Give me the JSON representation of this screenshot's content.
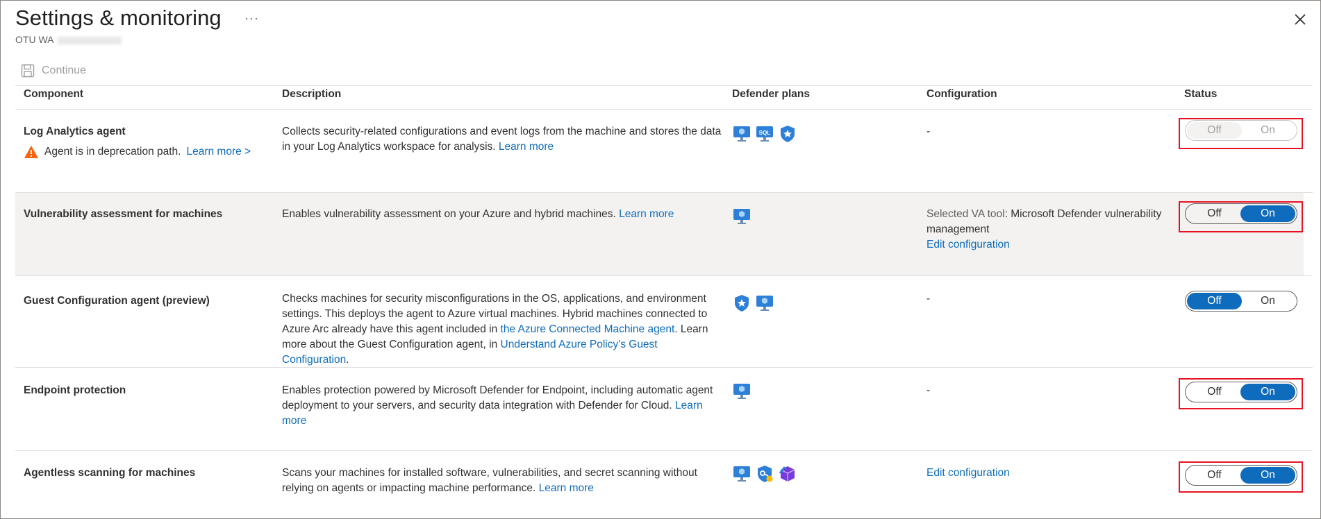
{
  "page": {
    "title": "Settings & monitoring",
    "more": "···",
    "subtitle_visible": "OTU WA"
  },
  "toolbar": {
    "continue_label": "Continue"
  },
  "columns": {
    "component": "Component",
    "description": "Description",
    "plans": "Defender plans",
    "configuration": "Configuration",
    "status": "Status"
  },
  "toggle_labels": {
    "off": "Off",
    "on": "On"
  },
  "rows": [
    {
      "name": "Log Analytics agent",
      "warning_text": "Agent is in deprecation path.",
      "warning_link": "Learn more >",
      "desc_text": "Collects security-related configurations and event logs from the machine and stores the data in your Log Analytics workspace for analysis.",
      "desc_link": "Learn more",
      "plans": [
        "server-monitor-icon",
        "sql-server-icon",
        "shield-star-icon"
      ],
      "config": "-",
      "status": "Off",
      "status_enabled": false
    },
    {
      "name": "Vulnerability assessment for machines",
      "desc_text": "Enables vulnerability assessment on your Azure and hybrid machines.",
      "desc_link": "Learn more",
      "plans": [
        "server-monitor-icon"
      ],
      "config_prefix": "Selected VA tool",
      "config_value": ": Microsoft Defender vulnerability management",
      "config_link": "Edit configuration",
      "status": "On",
      "status_enabled": true
    },
    {
      "name": "Guest Configuration agent (preview)",
      "desc_text": "Checks machines for security misconfigurations in the OS, applications, and environment settings. This deploys the agent to Azure virtual machines. Hybrid machines connected to Azure Arc already have this agent included in",
      "desc_link": "the Azure Connected Machine agent",
      "desc_text2": ". Learn more about the Guest Configuration agent, in",
      "desc_link2": "Understand Azure Policy's Guest Configuration",
      "desc_text3": ".",
      "plans": [
        "shield-star-icon",
        "server-monitor-icon"
      ],
      "config": "-",
      "status": "Off",
      "status_enabled": true
    },
    {
      "name": "Endpoint protection",
      "desc_text": "Enables protection powered by Microsoft Defender for Endpoint, including automatic agent deployment to your servers, and security data integration with Defender for Cloud.",
      "desc_link": "Learn more",
      "plans": [
        "server-monitor-icon"
      ],
      "config": "-",
      "status": "On",
      "status_enabled": true
    },
    {
      "name": "Agentless scanning for machines",
      "desc_text": "Scans your machines for installed software, vulnerabilities, and secret scanning without relying on agents or impacting machine performance.",
      "desc_link": "Learn more",
      "plans": [
        "server-monitor-icon",
        "shield-key-icon",
        "container-registry-icon"
      ],
      "config_link": "Edit configuration",
      "status": "On",
      "status_enabled": true
    }
  ],
  "colors": {
    "accent": "#0f6cbd",
    "highlight": "#e81123",
    "warning": "#f7630c"
  }
}
